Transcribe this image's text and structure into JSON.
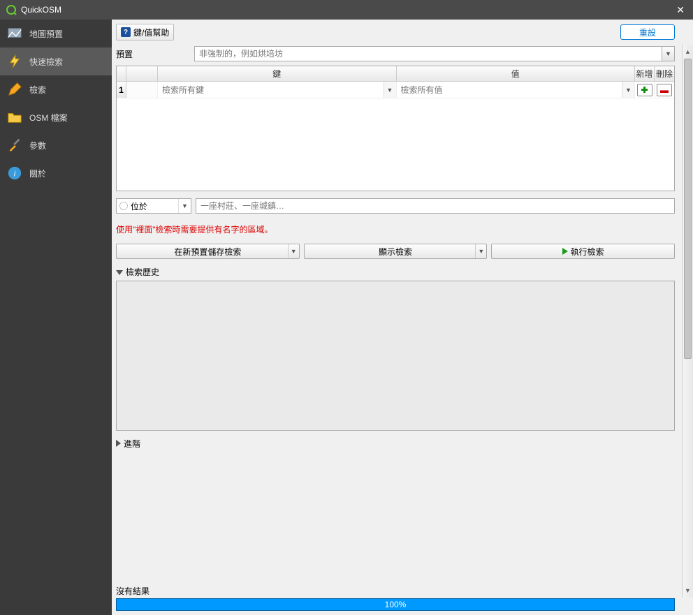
{
  "window": {
    "title": "QuickOSM"
  },
  "sidebar": {
    "items": [
      {
        "label": "地圖預置"
      },
      {
        "label": "快速檢索"
      },
      {
        "label": "檢索"
      },
      {
        "label": "OSM 檔案"
      },
      {
        "label": "參數"
      },
      {
        "label": "關於"
      }
    ]
  },
  "toolbar": {
    "help_label": "鍵/值幫助",
    "reset_label": "重設"
  },
  "preset": {
    "label": "預置",
    "placeholder": "非強制的，例如烘培坊"
  },
  "table": {
    "headers": {
      "key": "鍵",
      "value": "值",
      "add": "新增",
      "del": "刪除"
    },
    "row": {
      "num": "1",
      "key_placeholder": "檢索所有鍵",
      "value_placeholder": "檢索所有值"
    }
  },
  "location": {
    "mode": "位於",
    "placeholder": "一座村莊、一座城鎮…"
  },
  "warning": "使用\"裡面\"檢索時需要提供有名字的區域。",
  "actions": {
    "save_preset": "在新預置儲存檢索",
    "show_query": "顯示檢索",
    "run_query": "執行檢索"
  },
  "expanders": {
    "history": "檢索歷史",
    "advanced": "進階"
  },
  "status": {
    "text": "沒有結果",
    "progress": "100%"
  }
}
